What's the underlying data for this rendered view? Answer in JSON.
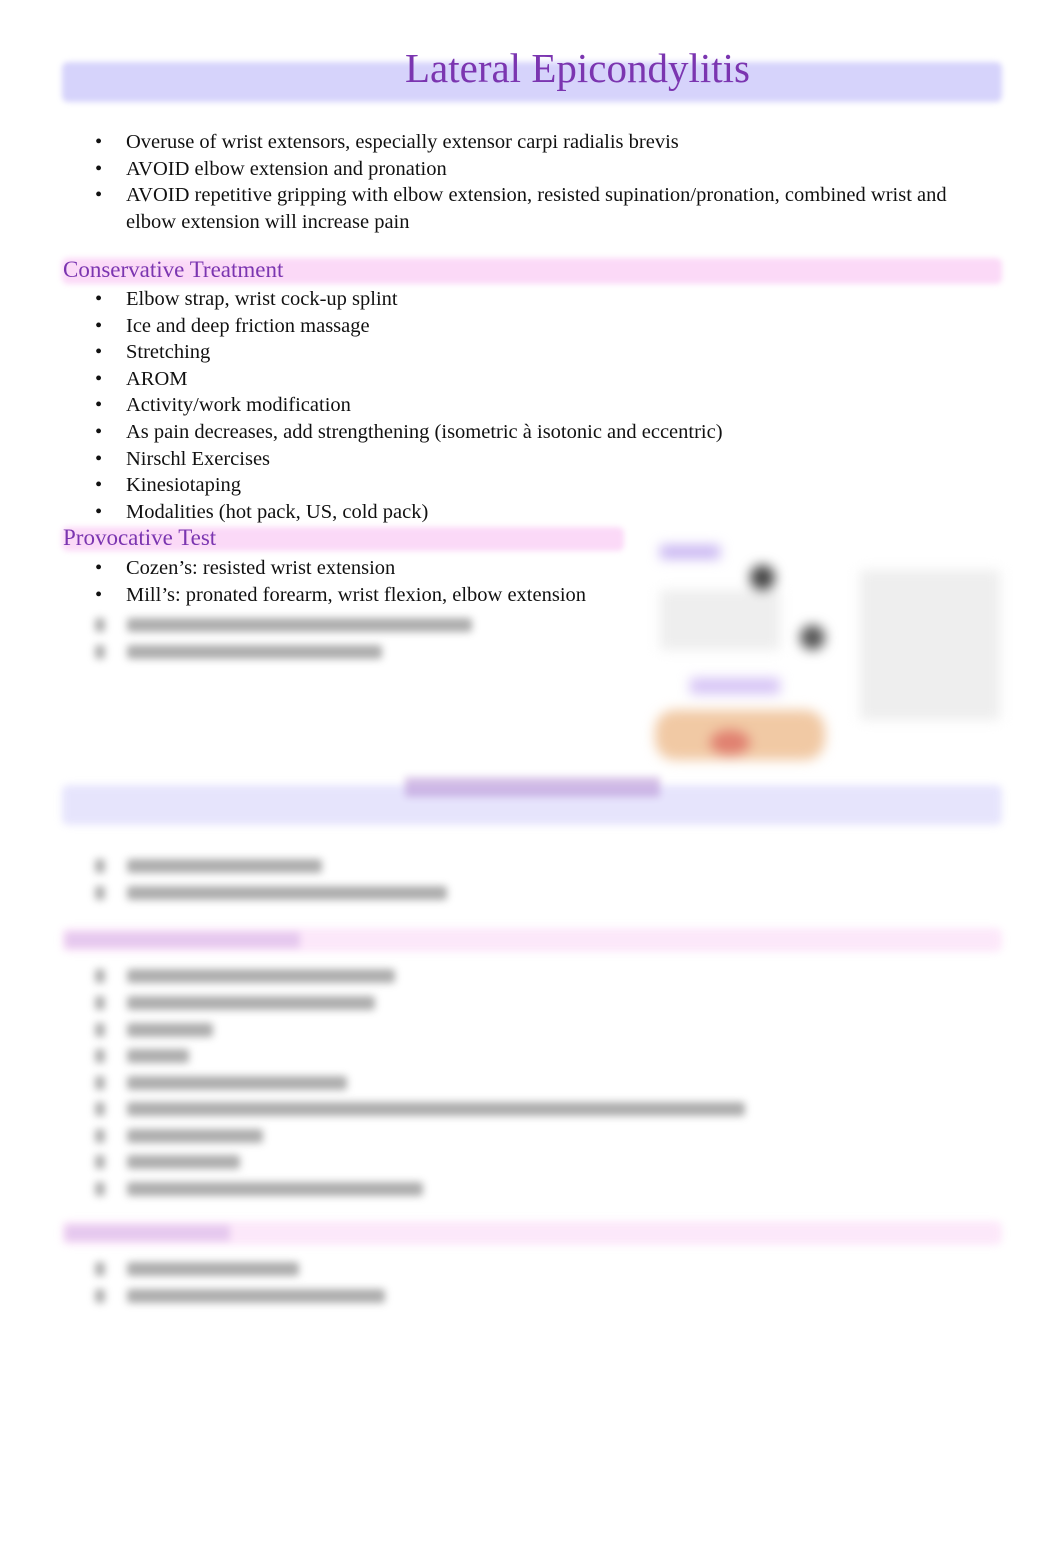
{
  "title": "Lateral Epicondylitis",
  "intro": [
    "Overuse of wrist extensors, especially extensor carpi radialis brevis",
    "AVOID elbow extension and pronation",
    "AVOID repetitive gripping with elbow extension, resisted supination/pronation, combined wrist and elbow extension will increase pain"
  ],
  "conservative": {
    "heading": "Conservative Treatment",
    "items": [
      "Elbow strap, wrist cock-up splint",
      "Ice and deep friction massage",
      "Stretching",
      "AROM",
      "Activity/work modification",
      "As pain decreases, add strengthening (isometric à   isotonic and eccentric)",
      "Nirschl Exercises",
      "Kinesiotaping",
      "Modalities (hot pack, US, cold pack)"
    ]
  },
  "provocative": {
    "heading": "Provocative Test",
    "items": [
      "Cozen’s: resisted wrist extension",
      "Mill’s: pronated forearm, wrist flexion, elbow extension"
    ]
  },
  "colors": {
    "heading": "#7b35b0",
    "title_band": "#d6d3fb",
    "section_band": "#fbd9f7"
  }
}
